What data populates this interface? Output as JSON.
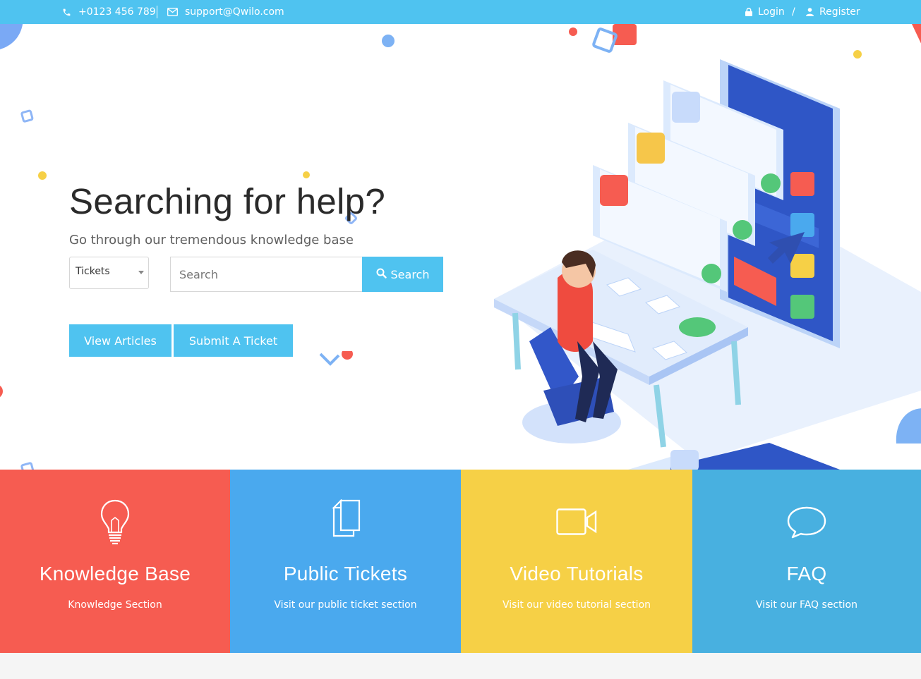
{
  "topbar": {
    "phone": "+0123 456 789",
    "email": "support@Qwilo.com",
    "login": "Login",
    "divider": "/",
    "register": "Register"
  },
  "hero": {
    "title": "Searching for help?",
    "subtitle": "Go through our tremendous knowledge base",
    "select_value": "Tickets",
    "search_placeholder": "Search",
    "search_button": "Search",
    "view_articles": "View Articles",
    "submit_ticket": "Submit A Ticket"
  },
  "tiles": [
    {
      "title": "Knowledge Base",
      "subtitle": "Knowledge Section",
      "icon": "lightbulb-icon",
      "color": "#f65c51"
    },
    {
      "title": "Public Tickets",
      "subtitle": "Visit our public ticket section",
      "icon": "documents-icon",
      "color": "#4aa9ee"
    },
    {
      "title": "Video Tutorials",
      "subtitle": "Visit our video tutorial section",
      "icon": "video-camera-icon",
      "color": "#f6d046"
    },
    {
      "title": "FAQ",
      "subtitle": "Visit our FAQ section",
      "icon": "speech-bubble-icon",
      "color": "#48b0e0"
    }
  ],
  "colors": {
    "accent": "#4fc3f0",
    "heading": "#2a2a2a",
    "subtext": "#606060"
  }
}
